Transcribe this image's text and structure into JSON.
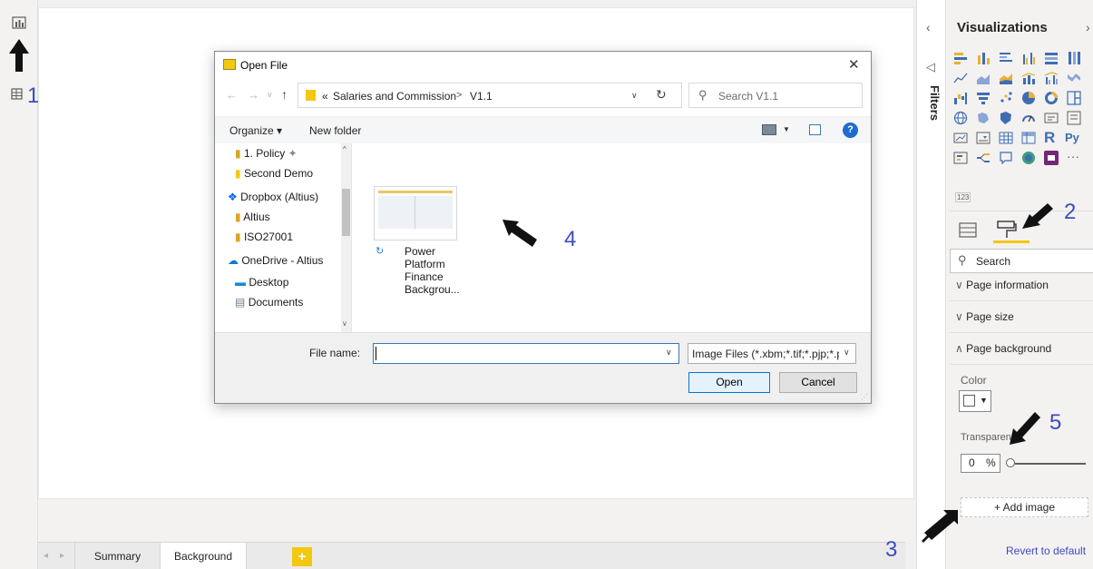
{
  "annotations": {
    "n1": "1",
    "n2": "2",
    "n3": "3",
    "n4": "4",
    "n5": "5"
  },
  "tabs": {
    "summary": "Summary",
    "background": "Background",
    "add": "+"
  },
  "filters": {
    "label": "Filters"
  },
  "visualizations": {
    "title": "Visualizations",
    "search_placeholder": "Search",
    "sections": {
      "page_information": "Page information",
      "page_size": "Page size",
      "page_background": "Page background"
    },
    "color_label": "Color",
    "transparency_label": "Transparency",
    "transparency_value": "0",
    "transparency_unit": "%",
    "add_image": "+ Add image",
    "revert": "Revert to default",
    "r_icon": "R",
    "py_icon": "Py",
    "more_icon": "···",
    "card_icon": "123"
  },
  "dialog": {
    "title": "Open File",
    "breadcrumb_prefix": "«",
    "breadcrumb_folder": "Salaries and Commission",
    "breadcrumb_sep": ">",
    "breadcrumb_current": "V1.1",
    "search_placeholder": "Search V1.1",
    "organize": "Organize ▾",
    "new_folder": "New folder",
    "tree": [
      "1. Policy",
      "Second Demo",
      "Dropbox (Altius)",
      "Altius",
      "ISO27001",
      "OneDrive - Altius",
      "Desktop",
      "Documents"
    ],
    "file": {
      "line1": "Power",
      "line2": "Platform",
      "line3": "Finance",
      "line4": "Backgrou..."
    },
    "filename_label": "File name:",
    "filename_value": "",
    "filetype": "Image Files (*.xbm;*.tif;*.pjp;*.pj",
    "open": "Open",
    "cancel": "Cancel"
  },
  "colors": {
    "accent_yellow": "#f2c811",
    "annotation_blue": "#3b4cc0",
    "windows_blue": "#0078d7"
  }
}
